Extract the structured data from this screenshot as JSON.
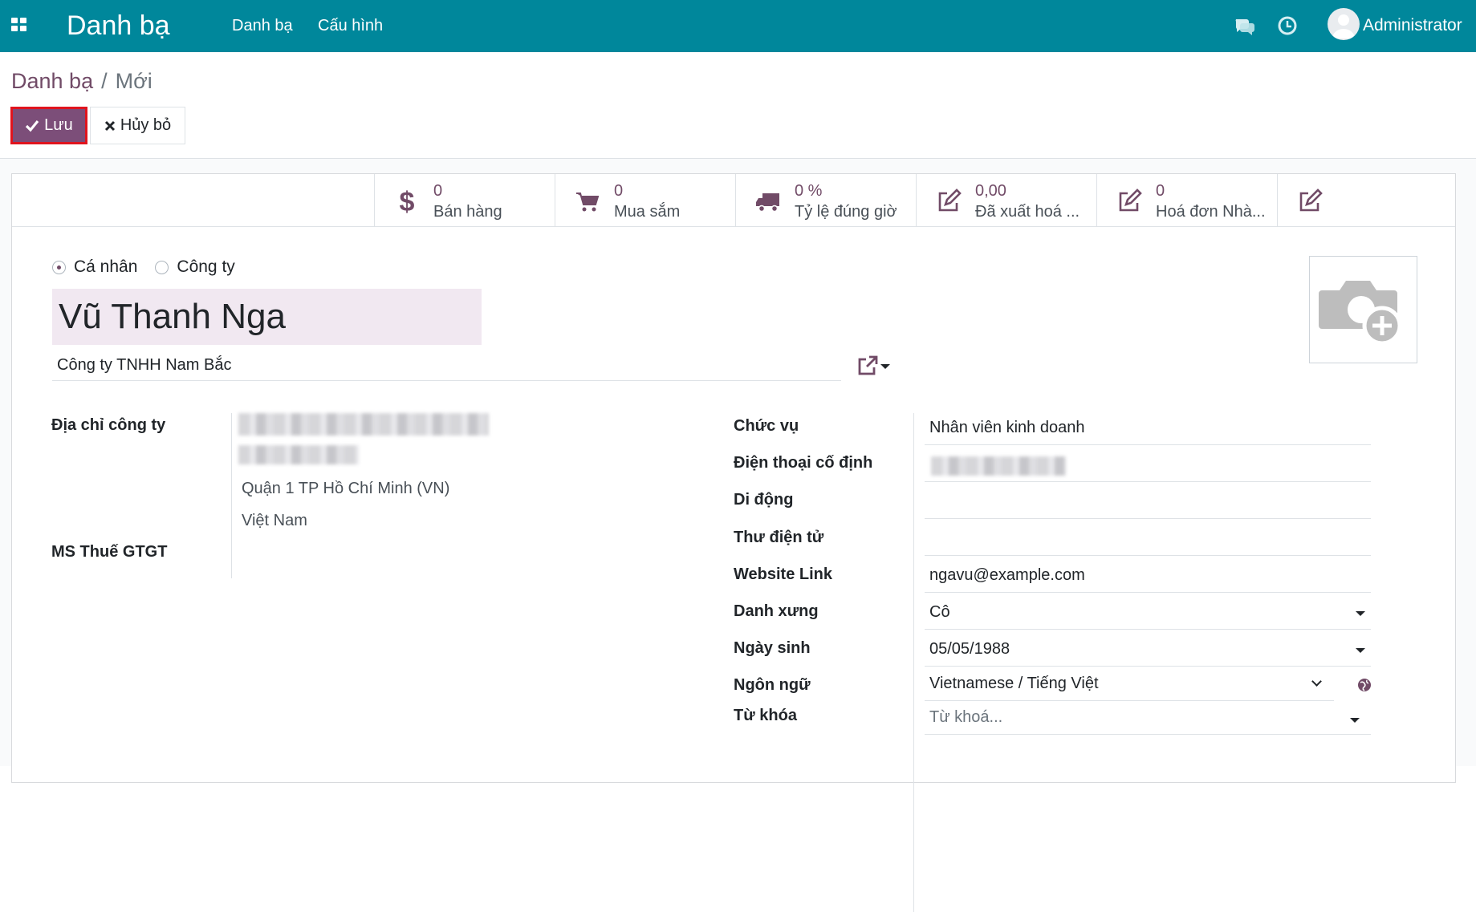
{
  "navbar": {
    "app_name": "Danh bạ",
    "menu": [
      "Danh bạ",
      "Cấu hình"
    ],
    "user": "Administrator",
    "icons": [
      "apps-icon",
      "chat-icon",
      "clock-icon",
      "avatar-icon"
    ]
  },
  "breadcrumb": {
    "parent": "Danh bạ",
    "separator": "/",
    "current": "Mới"
  },
  "buttons": {
    "save": "Lưu",
    "discard": "Hủy bỏ"
  },
  "stat_buttons": [
    {
      "icon": "dollar-icon",
      "value": "0",
      "label": "Bán hàng"
    },
    {
      "icon": "cart-icon",
      "value": "0",
      "label": "Mua sắm"
    },
    {
      "icon": "truck-icon",
      "value": "0 %",
      "label": "Tỷ lệ đúng giờ"
    },
    {
      "icon": "edit-icon",
      "value": "0,00",
      "label": "Đã xuất hoá ..."
    },
    {
      "icon": "edit-icon",
      "value": "0",
      "label": "Hoá đơn Nhà..."
    },
    {
      "icon": "edit-icon"
    }
  ],
  "company_type": {
    "options": [
      "Cá nhân",
      "Công ty"
    ],
    "selected": "Cá nhân"
  },
  "partner_name": "Vũ Thanh Nga",
  "parent_company": "Công ty TNHH Nam Bắc",
  "left_fields": {
    "address_label": "Địa chỉ công ty",
    "address_city_line": "Quận 1  TP Hồ Chí Minh (VN)",
    "address_country": "Việt Nam",
    "vat_label": "MS Thuế GTGT"
  },
  "right_fields": {
    "function_label": "Chức vụ",
    "function_value": "Nhân viên kinh doanh",
    "phone_label": "Điện thoại cố định",
    "mobile_label": "Di động",
    "email_label": "Thư điện tử",
    "website_label": "Website Link",
    "website_value": "ngavu@example.com",
    "title_label": "Danh xưng",
    "title_value": "Cô",
    "birthday_label": "Ngày sinh",
    "birthday_value": "05/05/1988",
    "lang_label": "Ngôn ngữ",
    "lang_value": "Vietnamese / Tiếng Việt",
    "tags_label": "Từ khóa",
    "tags_placeholder": "Từ khoá..."
  },
  "colors": {
    "navbar": "#00879b",
    "primary": "#7c4e79",
    "name_bg": "#f1e8f1",
    "highlight_border": "#e0141e"
  }
}
